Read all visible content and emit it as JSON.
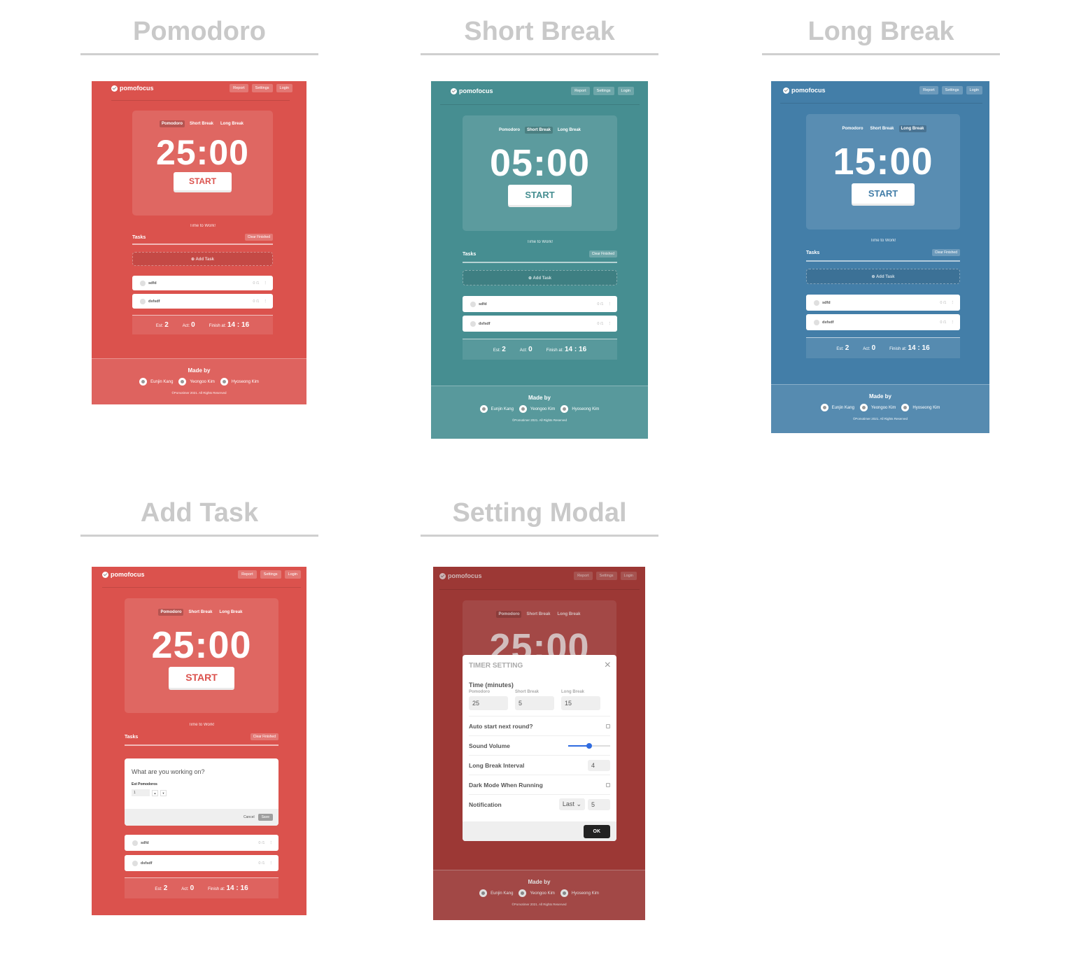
{
  "headings": {
    "pomodoro": "Pomodoro",
    "short_break": "Short Break",
    "long_break": "Long Break",
    "add_task": "Add Task",
    "setting_modal": "Setting Modal"
  },
  "app": {
    "brand": "pomofocus",
    "report": "Report",
    "settings": "Settings",
    "login": "Login",
    "tab_pomodoro": "Pomodoro",
    "tab_short": "Short Break",
    "tab_long": "Long Break",
    "start": "START",
    "subtitle": "Time to Work!",
    "tasks": "Tasks",
    "clear_finished": "Clear Finished",
    "add_task": "Add Task",
    "task1": "sdfd",
    "task2": "dsfsdf",
    "task_count": "0 /1",
    "est_label": "Est:",
    "est": "2",
    "act_label": "Act:",
    "act": "0",
    "finish_label": "Finish at:",
    "finish": "14 : 16",
    "made_by": "Made by",
    "person1": "Eunjin Kang",
    "person2": "Yeongoo Kim",
    "person3": "Hyoseong Kim",
    "copyright": "©Pomotimer 2021. All Rights Reserved"
  },
  "clocks": {
    "pomodoro": "25:00",
    "short_break": "05:00",
    "long_break": "15:00"
  },
  "form": {
    "question": "What are you working on?",
    "est_label": "Est Pomodoros",
    "est_value": "1",
    "cancel": "Cancel",
    "save": "Save"
  },
  "modal": {
    "title": "TIMER SETTING",
    "time_label": "Time (minutes)",
    "pomodoro_label": "Pomodoro",
    "short_label": "Short Break",
    "long_label": "Long Break",
    "pomodoro_value": "25",
    "short_value": "5",
    "long_value": "15",
    "auto_start": "Auto start next round?",
    "sound_volume": "Sound Volume",
    "volume_fraction": 0.5,
    "long_interval": "Long Break Interval",
    "long_interval_value": "4",
    "dark_mode": "Dark Mode When Running",
    "notification": "Notification",
    "notification_select": "Last",
    "notification_value": "5",
    "ok": "OK",
    "close": "×"
  },
  "colors": {
    "pomodoro": "#db524d",
    "short_break": "#468e91",
    "long_break": "#437ea8",
    "modal_bg": "#b2403d"
  }
}
